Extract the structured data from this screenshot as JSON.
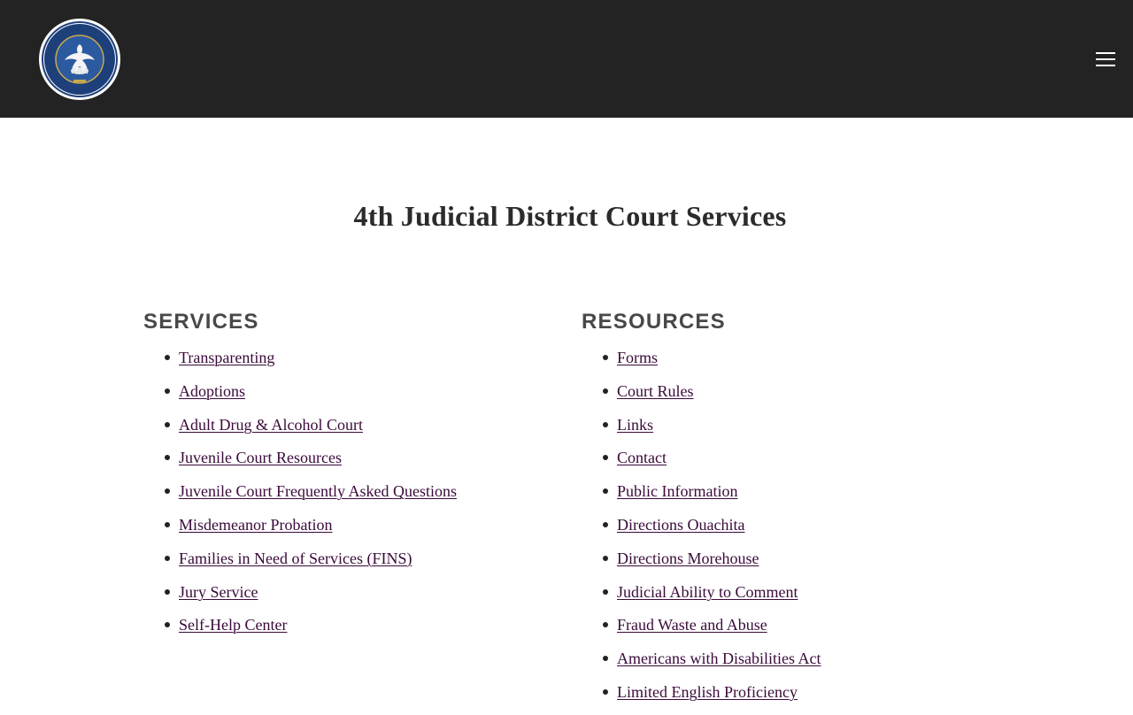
{
  "header": {
    "seal_icon": "state-of-louisiana-seal",
    "seal_text": "STATE OF LOUISIANA · UNION · JUSTICE · CONFIDENCE",
    "menu_icon": "hamburger-menu-icon",
    "background_color": "#232323"
  },
  "page": {
    "title": "4th Judicial District Court Services"
  },
  "services": {
    "heading": "SERVICES",
    "items": [
      "Transparenting",
      "Adoptions",
      "Adult Drug & Alcohol Court",
      "Juvenile Court Resources",
      "Juvenile Court Frequently Asked Questions",
      "Misdemeanor Probation",
      "Families in Need of Services (FINS)",
      "Jury Service",
      "Self-Help Center"
    ]
  },
  "resources": {
    "heading": "RESOURCES",
    "items": [
      "Forms",
      "Court Rules",
      "Links",
      "Contact",
      "Public Information",
      "Directions Ouachita",
      "Directions Morehouse",
      "Judicial Ability to Comment",
      "Fraud Waste and Abuse",
      "Americans with Disabilities Act",
      "Limited English Proficiency"
    ]
  },
  "colors": {
    "link": "#3a0a3a",
    "heading": "#4a4747",
    "title": "#2b2b2b"
  }
}
